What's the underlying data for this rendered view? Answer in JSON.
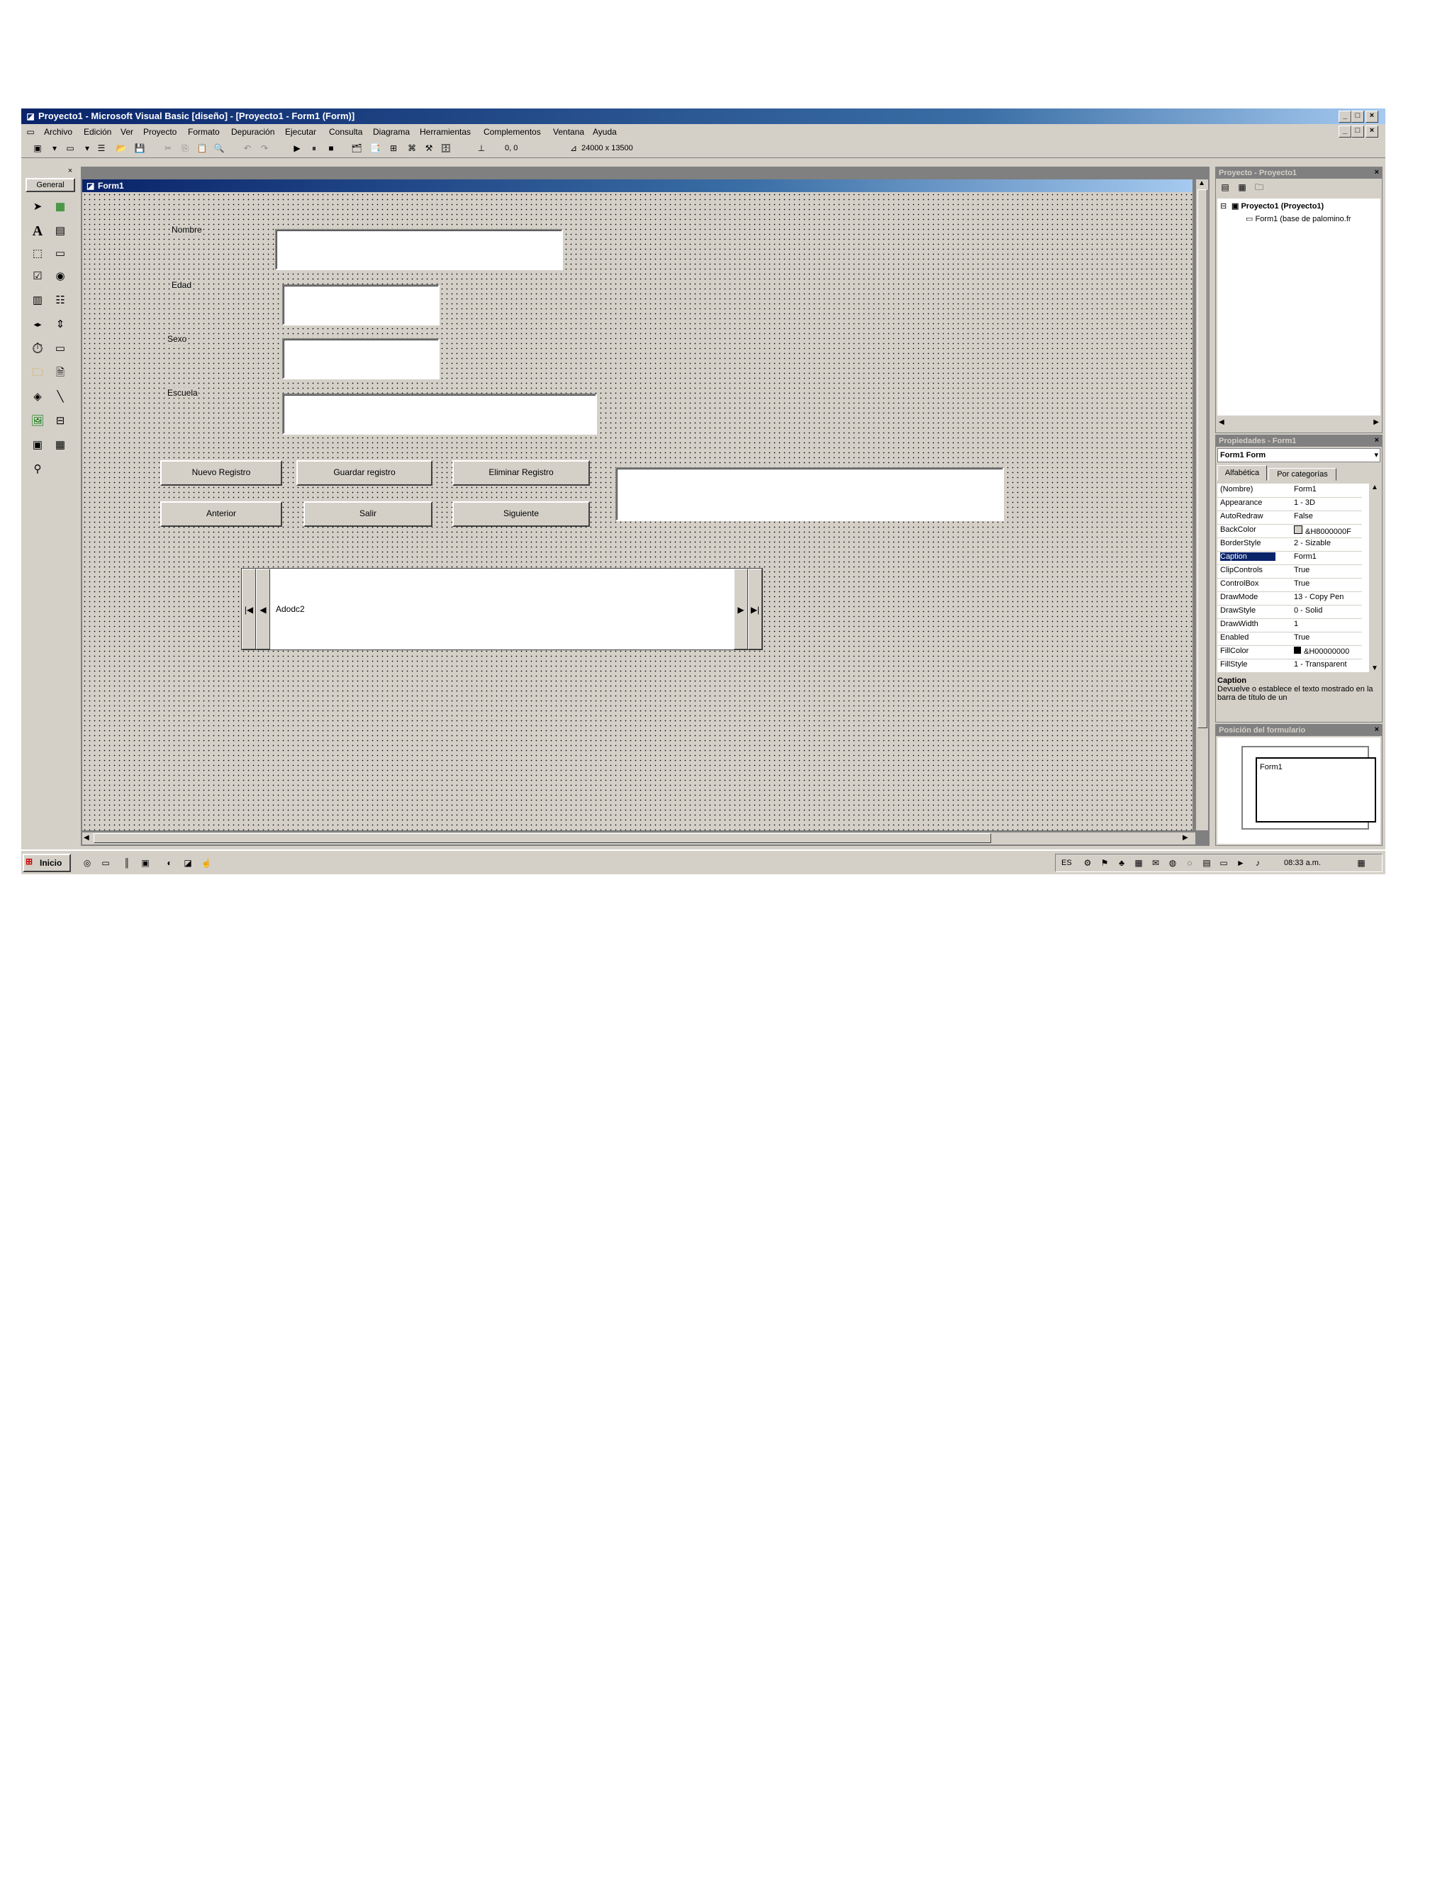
{
  "window": {
    "title": "Proyecto1 - Microsoft Visual Basic [diseño] - [Proyecto1 - Form1 (Form)]",
    "min": "_",
    "max": "□",
    "close": "×"
  },
  "menu": {
    "items": [
      "Archivo",
      "Edición",
      "Ver",
      "Proyecto",
      "Formato",
      "Depuración",
      "Ejecutar",
      "Consulta",
      "Diagrama",
      "Herramientas",
      "Complementos",
      "Ventana",
      "Ayuda"
    ]
  },
  "toolbar": {
    "position": "0, 0",
    "size": "24000 x 13500"
  },
  "toolbox": {
    "tab_label": "General"
  },
  "form": {
    "title": "Form1",
    "labels": {
      "nombre": "Nombre",
      "edad": "Edad",
      "sexo": "Sexo",
      "escuela": "Escuela"
    },
    "buttons": {
      "nuevo": "Nuevo Registro",
      "guardar": "Guardar registro",
      "eliminar": "Eliminar Registro",
      "anterior": "Anterior",
      "salir": "Salir",
      "siguiente": "Siguiente"
    },
    "adodc": {
      "caption": "Adodc2",
      "first": "|◀",
      "prev": "◀",
      "next": "▶",
      "last": "▶|"
    }
  },
  "project_panel": {
    "title": "Proyecto - Proyecto1",
    "root": "Proyecto1 (Proyecto1)",
    "child": "Form1 (base de palomino.fr"
  },
  "properties_panel": {
    "title": "Propiedades - Form1",
    "object": "Form1 Form",
    "tabs": [
      "Alfabética",
      "Por categorías"
    ],
    "rows": [
      {
        "k": "(Nombre)",
        "v": "Form1"
      },
      {
        "k": "Appearance",
        "v": "1 - 3D"
      },
      {
        "k": "AutoRedraw",
        "v": "False"
      },
      {
        "k": "BackColor",
        "v": "&H8000000F"
      },
      {
        "k": "BorderStyle",
        "v": "2 - Sizable"
      },
      {
        "k": "Caption",
        "v": "Form1"
      },
      {
        "k": "ClipControls",
        "v": "True"
      },
      {
        "k": "ControlBox",
        "v": "True"
      },
      {
        "k": "DrawMode",
        "v": "13 - Copy Pen"
      },
      {
        "k": "DrawStyle",
        "v": "0 - Solid"
      },
      {
        "k": "DrawWidth",
        "v": "1"
      },
      {
        "k": "Enabled",
        "v": "True"
      },
      {
        "k": "FillColor",
        "v": "&H00000000"
      },
      {
        "k": "FillStyle",
        "v": "1 - Transparent"
      }
    ],
    "selected_row": 5,
    "desc_title": "Caption",
    "desc_text": "Devuelve o establece el texto mostrado en la barra de título de un"
  },
  "layout_panel": {
    "title": "Posición del formulario",
    "preview_label": "Form1"
  },
  "taskbar": {
    "start": "Inicio",
    "lang": "ES",
    "clock": "08:33 a.m."
  },
  "colors": {
    "face": "#d4d0c8",
    "titlebar_active": "#0a246a",
    "selection": "#0a246a"
  }
}
